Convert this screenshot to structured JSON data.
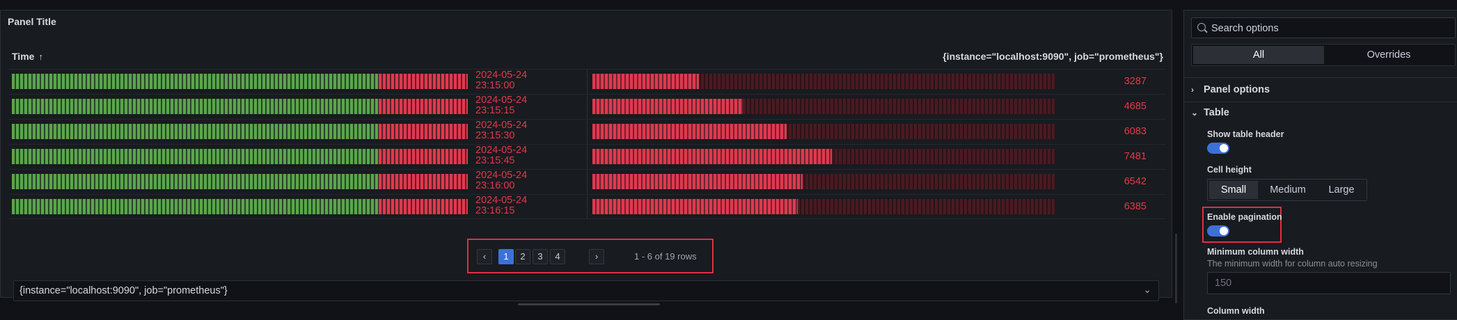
{
  "panel": {
    "title": "Panel Title",
    "columns": {
      "time": "Time",
      "time_sort_icon": "arrow-up-icon",
      "series": "{instance=\"localhost:9090\", job=\"prometheus\"}"
    },
    "rows": [
      {
        "date": "2024-05-24",
        "time": "23:15:00",
        "value": "3287",
        "gauge_fraction": 0.23
      },
      {
        "date": "2024-05-24",
        "time": "23:15:15",
        "value": "4685",
        "gauge_fraction": 0.325
      },
      {
        "date": "2024-05-24",
        "time": "23:15:30",
        "value": "6083",
        "gauge_fraction": 0.42
      },
      {
        "date": "2024-05-24",
        "time": "23:15:45",
        "value": "7481",
        "gauge_fraction": 0.518
      },
      {
        "date": "2024-05-24",
        "time": "23:16:00",
        "value": "6542",
        "gauge_fraction": 0.455
      },
      {
        "date": "2024-05-24",
        "time": "23:16:15",
        "value": "6385",
        "gauge_fraction": 0.445
      }
    ],
    "pagination": {
      "prev": "‹",
      "pages": [
        "1",
        "2",
        "3",
        "4"
      ],
      "active_page": "1",
      "next": "›",
      "info": "1 - 6 of 19 rows"
    },
    "series_select": {
      "value": "{instance=\"localhost:9090\", job=\"prometheus\"}",
      "icon": "chevron-down-icon"
    }
  },
  "options": {
    "search_placeholder": "Search options",
    "tabs": [
      "All",
      "Overrides"
    ],
    "active_tab": "All",
    "sections": {
      "panel_options": "Panel options",
      "table": "Table"
    },
    "show_table_header": {
      "label": "Show table header",
      "on": true
    },
    "cell_height": {
      "label": "Cell height",
      "options": [
        "Small",
        "Medium",
        "Large"
      ],
      "selected": "Small"
    },
    "enable_pagination": {
      "label": "Enable pagination",
      "on": true
    },
    "min_column_width": {
      "label": "Minimum column width",
      "description": "The minimum width for column auto resizing",
      "placeholder": "150"
    },
    "column_width": {
      "label": "Column width"
    },
    "colors": {
      "accent": "#3d71d9",
      "gauge_red": "#e0394e",
      "gauge_green": "#5aa64b",
      "highlight": "#e02f44"
    }
  }
}
